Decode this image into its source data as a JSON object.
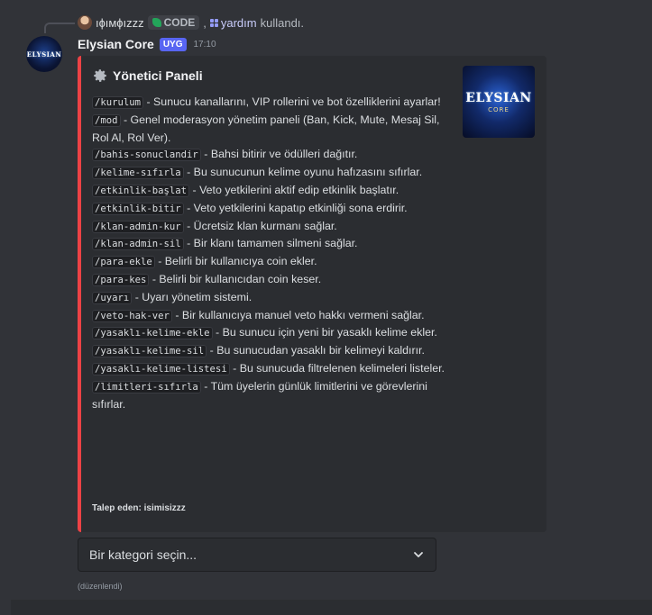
{
  "reply": {
    "user": "ıɸıмɸızzz",
    "command_chip": "CODE",
    "separator": ",",
    "mention": "yardım",
    "action": "kullandı."
  },
  "message": {
    "username": "Elysian Core",
    "tag": "UYG",
    "timestamp": "17:10",
    "avatar_text": "ELYSIAN",
    "edited": "(düzenlendi)"
  },
  "embed": {
    "accent_color": "#ed4245",
    "title": "Yönetici Paneli",
    "thumbnail_title": "ELYSIAN",
    "thumbnail_sub": "CORE",
    "commands": [
      {
        "cmd": "/kurulum",
        "desc": " - Sunucu kanallarını, VIP rollerini ve bot özelliklerini ayarlar!"
      },
      {
        "cmd": "/mod",
        "desc": " - Genel moderasyon yönetim paneli (Ban, Kick, Mute, Mesaj Sil, Rol Al, Rol Ver)."
      },
      {
        "cmd": "/bahis-sonuclandir",
        "desc": " - Bahsi bitirir ve ödülleri dağıtır."
      },
      {
        "cmd": "/kelime-sıfırla",
        "desc": " - Bu sunucunun kelime oyunu hafızasını sıfırlar."
      },
      {
        "cmd": "/etkinlik-başlat",
        "desc": " - Veto yetkilerini aktif edip etkinlik başlatır."
      },
      {
        "cmd": "/etkinlik-bitir",
        "desc": " - Veto yetkilerini kapatıp etkinliği sona erdirir."
      },
      {
        "cmd": "/klan-admin-kur",
        "desc": " - Ücretsiz klan kurmanı sağlar."
      },
      {
        "cmd": "/klan-admin-sil",
        "desc": " - Bir klanı tamamen silmeni sağlar."
      },
      {
        "cmd": "/para-ekle",
        "desc": " - Belirli bir kullanıcıya coin ekler."
      },
      {
        "cmd": "/para-kes",
        "desc": " - Belirli bir kullanıcıdan coin keser."
      },
      {
        "cmd": "/uyarı",
        "desc": " - Uyarı yönetim sistemi."
      },
      {
        "cmd": "/veto-hak-ver",
        "desc": " - Bir kullanıcıya manuel veto hakkı vermeni sağlar."
      },
      {
        "cmd": "/yasaklı-kelime-ekle",
        "desc": " - Bu sunucu için yeni bir yasaklı kelime ekler."
      },
      {
        "cmd": "/yasaklı-kelime-sil",
        "desc": " - Bu sunucudan yasaklı bir kelimeyi kaldırır."
      },
      {
        "cmd": "/yasaklı-kelime-listesi",
        "desc": " - Bu sunucuda filtrelenen kelimeleri listeler."
      },
      {
        "cmd": "/limitleri-sıfırla",
        "desc": " - Tüm üyelerin günlük limitlerini ve görevlerini sıfırlar."
      }
    ],
    "footer": "Talep eden: isimisizzz"
  },
  "select_menu": {
    "placeholder": "Bir kategori seçin..."
  },
  "icons": {
    "title": "gear-icon",
    "select": "chevron-down-icon",
    "mention": "slash-command-icon"
  }
}
